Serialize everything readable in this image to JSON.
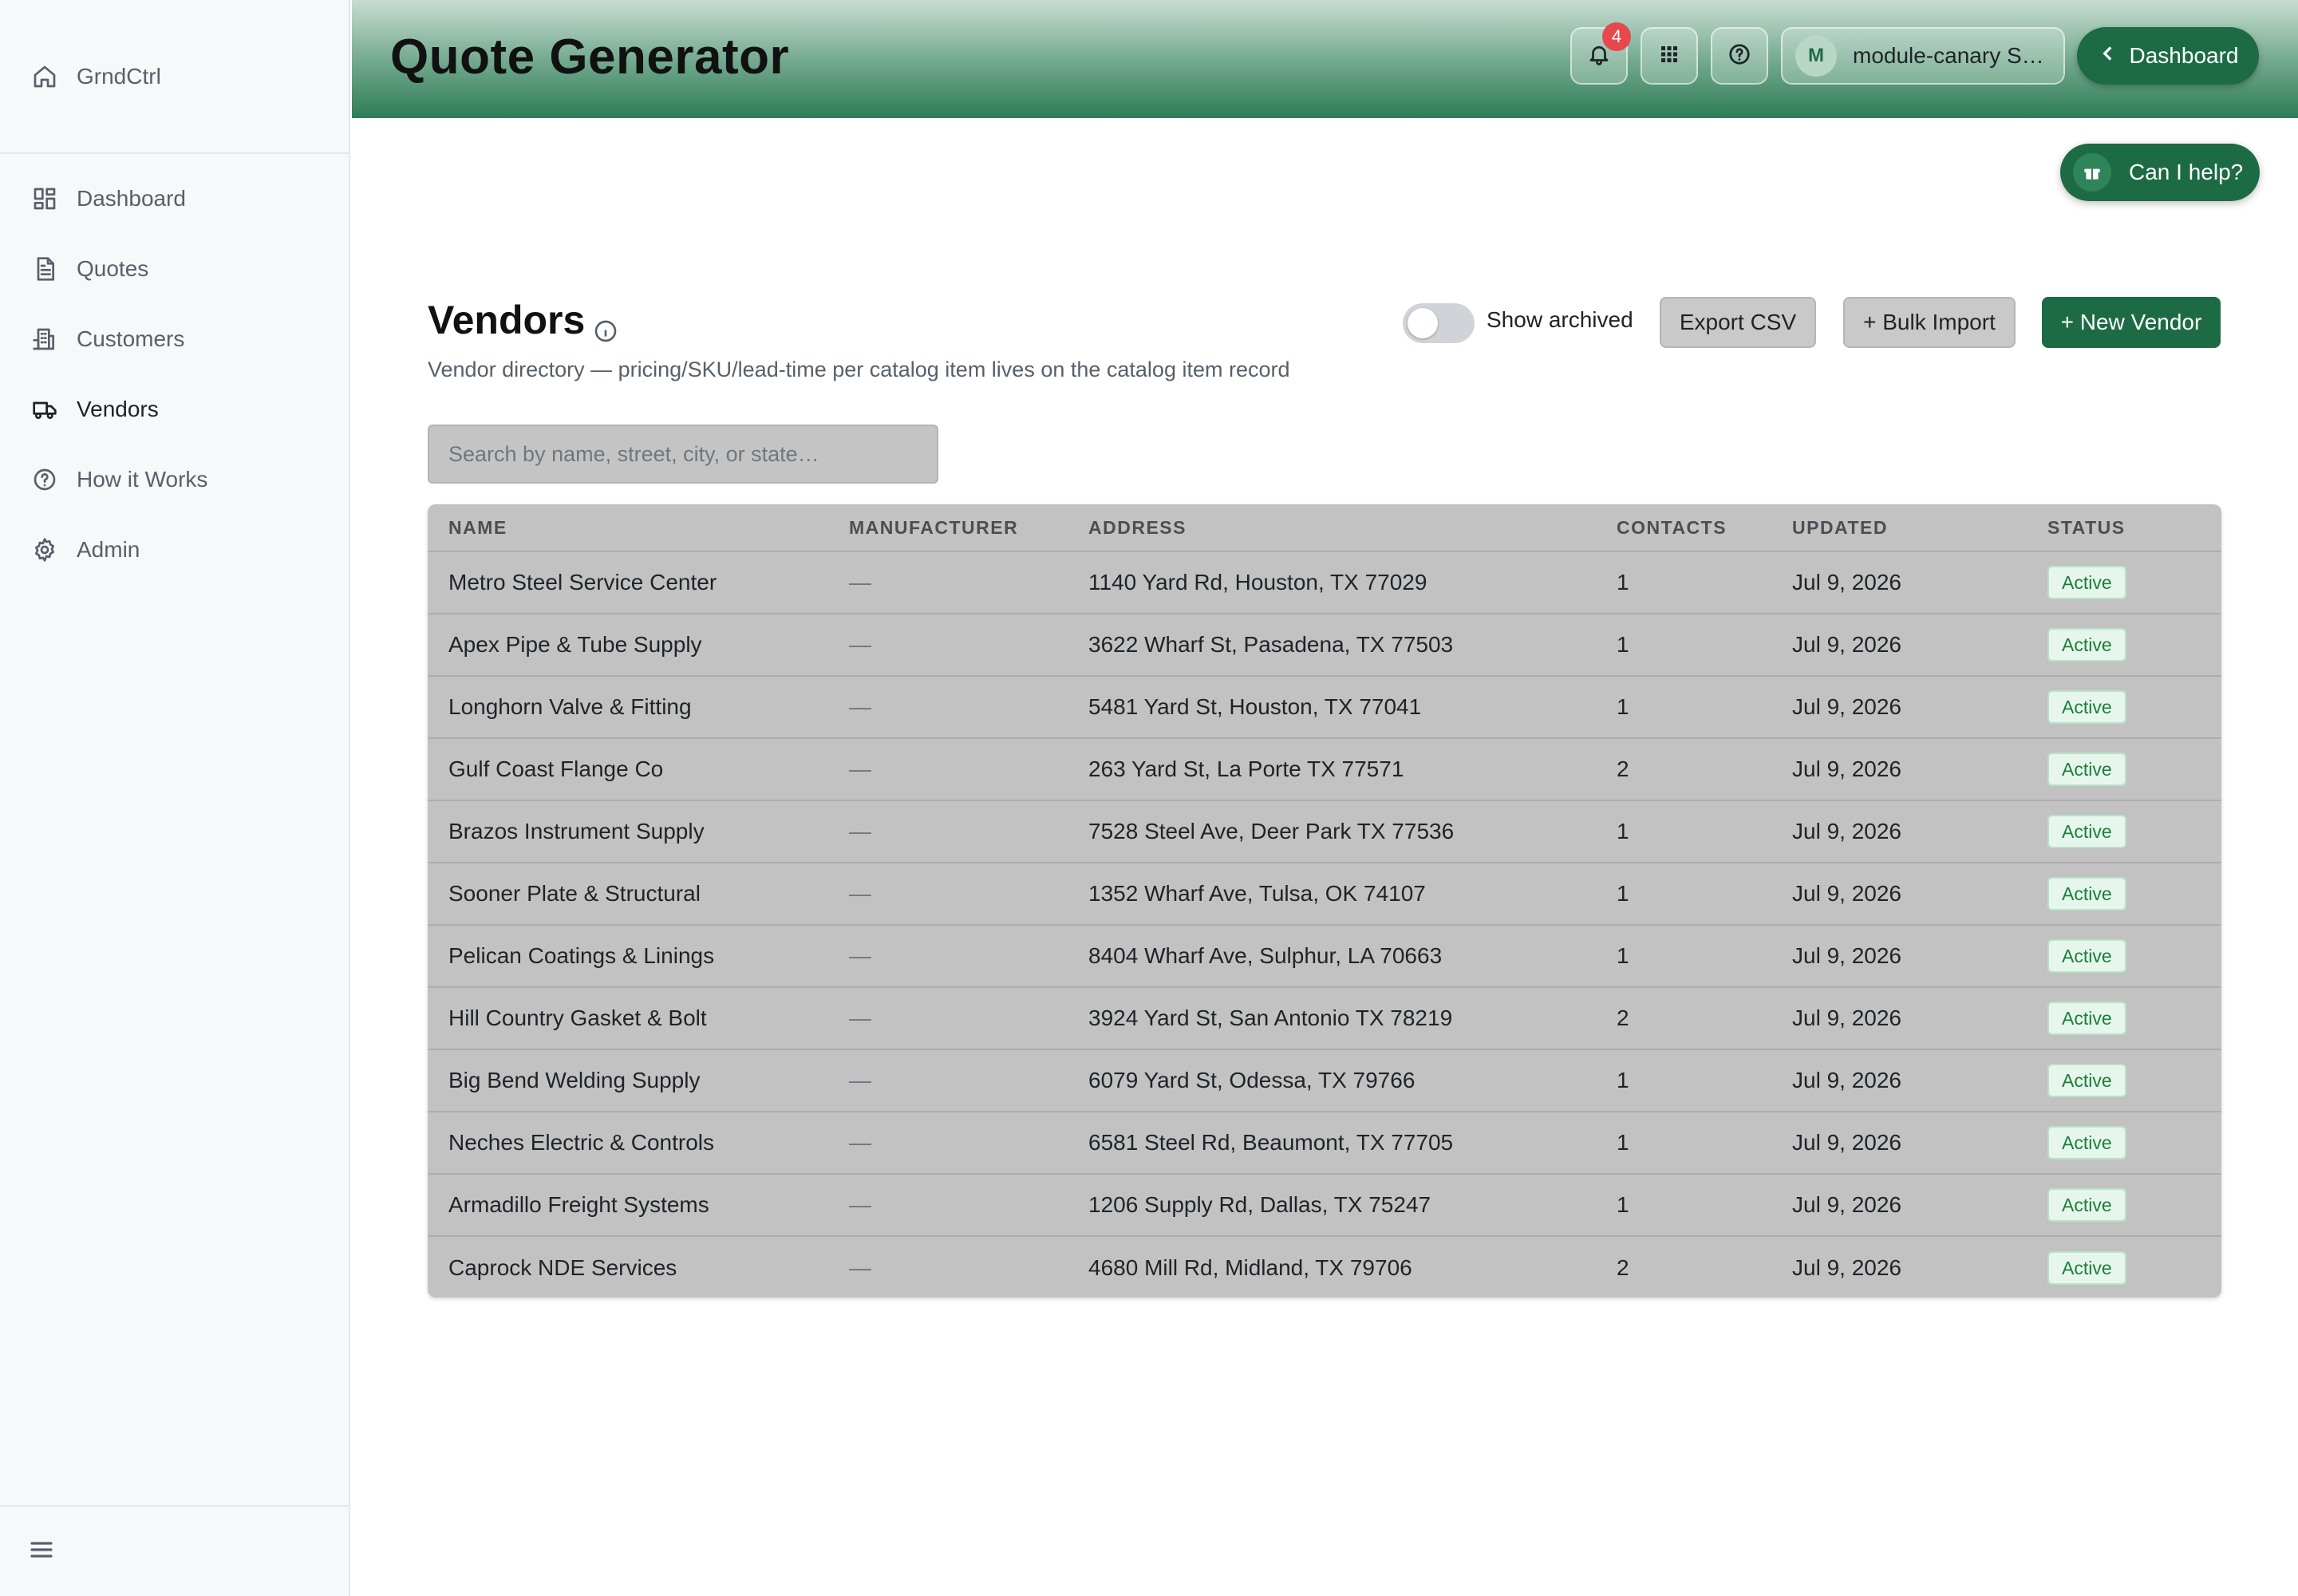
{
  "sidebar": {
    "brand": "GrndCtrl",
    "items": [
      {
        "label": "Dashboard",
        "icon": "dashboard-icon"
      },
      {
        "label": "Quotes",
        "icon": "document-icon"
      },
      {
        "label": "Customers",
        "icon": "building-icon"
      },
      {
        "label": "Vendors",
        "icon": "truck-icon"
      },
      {
        "label": "How it Works",
        "icon": "help-circle-icon"
      },
      {
        "label": "Admin",
        "icon": "gear-icon"
      }
    ],
    "active": "Vendors"
  },
  "header": {
    "title": "Quote Generator",
    "notifications_count": "4",
    "user_initial": "M",
    "user_name": "module-canary S…",
    "dashboard_label": "Dashboard"
  },
  "help": {
    "label": "Can I help?"
  },
  "section": {
    "title": "Vendors",
    "subtitle": "Vendor directory — pricing/SKU/lead-time per catalog item lives on the catalog item record",
    "show_archived_label": "Show archived",
    "show_archived": false,
    "export_label": "Export CSV",
    "bulk_import_label": "+ Bulk Import",
    "new_vendor_label": "+ New Vendor"
  },
  "search": {
    "placeholder": "Search by name, street, city, or state…"
  },
  "table": {
    "columns": [
      "NAME",
      "MANUFACTURER",
      "ADDRESS",
      "CONTACTS",
      "UPDATED",
      "STATUS"
    ],
    "rows": [
      {
        "name": "Metro Steel Service Center",
        "manufacturer": "—",
        "address": "1140 Yard Rd, Houston, TX 77029",
        "contacts": "1",
        "updated": "Jul 9, 2026",
        "status": "Active"
      },
      {
        "name": "Apex Pipe & Tube Supply",
        "manufacturer": "—",
        "address": "3622 Wharf St, Pasadena, TX 77503",
        "contacts": "1",
        "updated": "Jul 9, 2026",
        "status": "Active"
      },
      {
        "name": "Longhorn Valve & Fitting",
        "manufacturer": "—",
        "address": "5481 Yard St, Houston, TX 77041",
        "contacts": "1",
        "updated": "Jul 9, 2026",
        "status": "Active"
      },
      {
        "name": "Gulf Coast Flange Co",
        "manufacturer": "—",
        "address": "263 Yard St, La Porte TX 77571",
        "contacts": "2",
        "updated": "Jul 9, 2026",
        "status": "Active"
      },
      {
        "name": "Brazos Instrument Supply",
        "manufacturer": "—",
        "address": "7528 Steel Ave, Deer Park TX 77536",
        "contacts": "1",
        "updated": "Jul 9, 2026",
        "status": "Active"
      },
      {
        "name": "Sooner Plate & Structural",
        "manufacturer": "—",
        "address": "1352 Wharf Ave, Tulsa, OK 74107",
        "contacts": "1",
        "updated": "Jul 9, 2026",
        "status": "Active"
      },
      {
        "name": "Pelican Coatings & Linings",
        "manufacturer": "—",
        "address": "8404 Wharf Ave, Sulphur, LA 70663",
        "contacts": "1",
        "updated": "Jul 9, 2026",
        "status": "Active"
      },
      {
        "name": "Hill Country Gasket & Bolt",
        "manufacturer": "—",
        "address": "3924 Yard St, San Antonio TX 78219",
        "contacts": "2",
        "updated": "Jul 9, 2026",
        "status": "Active"
      },
      {
        "name": "Big Bend Welding Supply",
        "manufacturer": "—",
        "address": "6079 Yard St, Odessa, TX 79766",
        "contacts": "1",
        "updated": "Jul 9, 2026",
        "status": "Active"
      },
      {
        "name": "Neches Electric & Controls",
        "manufacturer": "—",
        "address": "6581 Steel Rd, Beaumont, TX 77705",
        "contacts": "1",
        "updated": "Jul 9, 2026",
        "status": "Active"
      },
      {
        "name": "Armadillo Freight Systems",
        "manufacturer": "—",
        "address": "1206 Supply Rd, Dallas, TX 75247",
        "contacts": "1",
        "updated": "Jul 9, 2026",
        "status": "Active"
      },
      {
        "name": "Caprock NDE Services",
        "manufacturer": "—",
        "address": "4680 Mill Rd, Midland, TX 79706",
        "contacts": "2",
        "updated": "Jul 9, 2026",
        "status": "Active"
      }
    ]
  },
  "colors": {
    "accent": "#1d6b45",
    "status_active_bg": "#e7f6ec",
    "status_active_text": "#1a7f3b",
    "badge": "#e5484d"
  }
}
